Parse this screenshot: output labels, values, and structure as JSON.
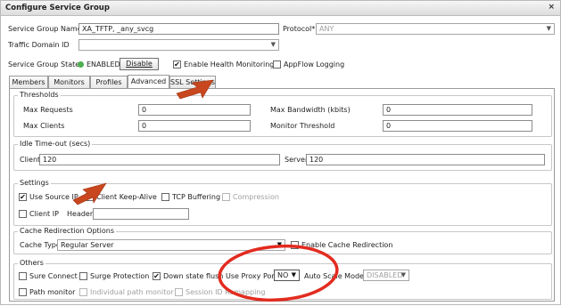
{
  "dialog": {
    "title": "Configure Service Group",
    "close_glyph": "×"
  },
  "form": {
    "service_group_name_label": "Service Group Name*",
    "service_group_name_value": "XA_TFTP,            _any_svcg",
    "protocol_label": "Protocol*",
    "protocol_value": "ANY",
    "traffic_domain_label": "Traffic Domain ID",
    "traffic_domain_value": "",
    "state_label": "Service Group State",
    "state_value": "ENABLED",
    "state_color": "#4caf50",
    "disable_button": "Disable",
    "health_monitoring_label": "Enable Health Monitoring",
    "health_monitoring_checked": true,
    "appflow_label": "AppFlow Logging",
    "appflow_checked": false
  },
  "tabs": [
    {
      "label": "Members",
      "active": false
    },
    {
      "label": "Monitors",
      "active": false
    },
    {
      "label": "Profiles",
      "active": false
    },
    {
      "label": "Advanced",
      "active": true
    },
    {
      "label": "SSL Settings",
      "active": false
    }
  ],
  "thresholds": {
    "legend": "Thresholds",
    "max_requests_label": "Max Requests",
    "max_requests_value": "0",
    "max_bandwidth_label": "Max Bandwidth (kbits)",
    "max_bandwidth_value": "0",
    "max_clients_label": "Max Clients",
    "max_clients_value": "0",
    "monitor_threshold_label": "Monitor Threshold",
    "monitor_threshold_value": "0"
  },
  "idle_timeout": {
    "legend": "Idle Time-out (secs)",
    "client_label": "Client",
    "client_value": "120",
    "server_label": "Server",
    "server_value": "120"
  },
  "settings": {
    "legend": "Settings",
    "use_source_ip_label": "Use Source IP",
    "use_source_ip_checked": true,
    "client_keepalive_label": "Client Keep-Alive",
    "client_keepalive_checked": false,
    "tcp_buffering_label": "TCP Buffering",
    "tcp_buffering_checked": false,
    "compression_label": "Compression",
    "compression_checked": false,
    "client_ip_label": "Client IP",
    "client_ip_checked": false,
    "header_label": "Header",
    "header_value": ""
  },
  "cache_redirection": {
    "legend": "Cache Redirection Options",
    "cache_type_label": "Cache Type",
    "cache_type_value": "Regular Server",
    "enable_cache_label": "Enable Cache Redirection",
    "enable_cache_checked": false
  },
  "others": {
    "legend": "Others",
    "sure_connect_label": "Sure Connect",
    "sure_connect_checked": false,
    "surge_protection_label": "Surge Protection",
    "surge_protection_checked": false,
    "down_state_flush_label": "Down state flush",
    "down_state_flush_checked": true,
    "use_proxy_port_label": "Use Proxy Port",
    "use_proxy_port_value": "NO",
    "auto_scale_label": "Auto Scale Mode",
    "auto_scale_value": "DISABLED",
    "path_monitor_label": "Path monitor",
    "path_monitor_checked": false,
    "individual_path_label": "Individual path monitor",
    "individual_path_checked": false,
    "session_id_label": "Session ID Remapping",
    "session_id_checked": false
  },
  "annotations": {
    "arrow_color": "#c8471e",
    "ellipse_color": "#e32b1f"
  }
}
